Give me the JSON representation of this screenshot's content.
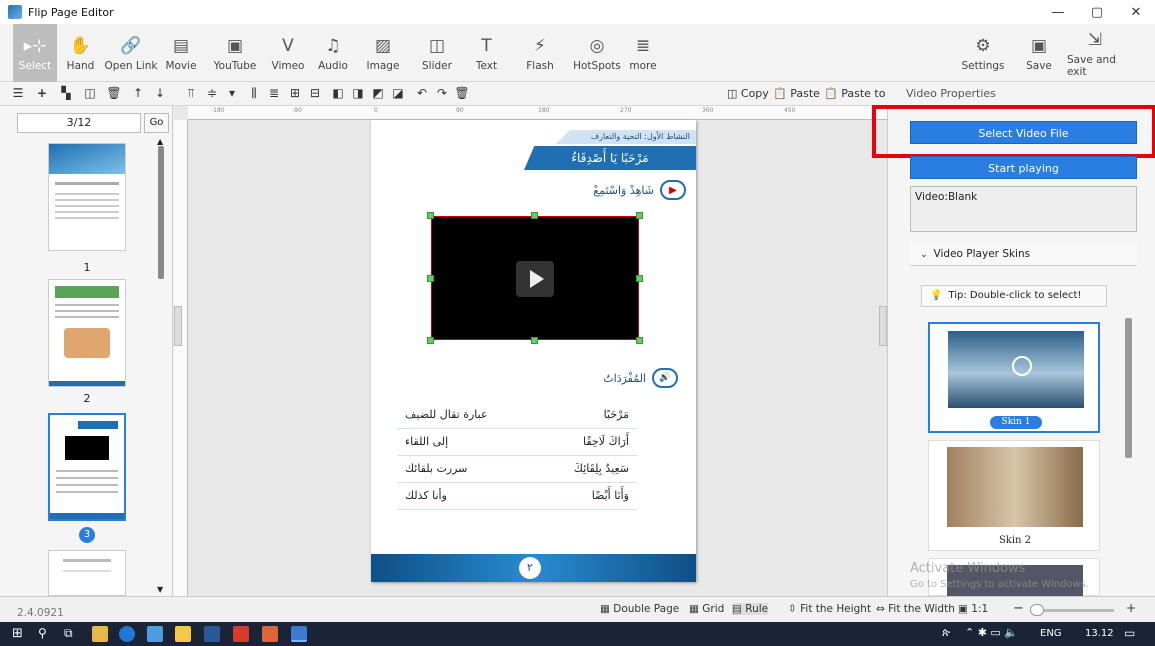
{
  "window": {
    "title": "Flip Page Editor",
    "min": "—",
    "max": "▢",
    "close": "✕"
  },
  "toolbar": [
    {
      "label": "Select",
      "icon": "▸⊹",
      "name": "select"
    },
    {
      "label": "Hand",
      "icon": "✋",
      "name": "hand"
    },
    {
      "label": "Open Link",
      "icon": "🔗",
      "name": "open-link"
    },
    {
      "label": "Movie",
      "icon": "▤",
      "name": "movie"
    },
    {
      "label": "YouTube",
      "icon": "▣",
      "name": "youtube"
    },
    {
      "label": "Vimeo",
      "icon": "V",
      "name": "vimeo"
    },
    {
      "label": "Audio",
      "icon": "♫",
      "name": "audio"
    },
    {
      "label": "Image",
      "icon": "▨",
      "name": "image"
    },
    {
      "label": "Slider",
      "icon": "◫",
      "name": "slider"
    },
    {
      "label": "Text",
      "icon": "T",
      "name": "text"
    },
    {
      "label": "Flash",
      "icon": "⚡",
      "name": "flash"
    },
    {
      "label": "HotSpots",
      "icon": "◎",
      "name": "hotspots"
    },
    {
      "label": "more",
      "icon": "≣",
      "name": "more"
    }
  ],
  "toolbar_right": [
    {
      "label": "Settings",
      "icon": "⚙",
      "name": "settings"
    },
    {
      "label": "Save",
      "icon": "▣",
      "name": "save"
    },
    {
      "label": "Save and exit",
      "icon": "⇲",
      "name": "save-and-exit"
    }
  ],
  "subtoolbar": {
    "copy": "Copy",
    "paste": "Paste",
    "paste_to": "Paste to",
    "panel_title": "Video Properties"
  },
  "pages": {
    "current": "3/12",
    "go": "Go",
    "thumbs": [
      "1",
      "2",
      "3"
    ]
  },
  "ruler": [
    "-180",
    "-90",
    "0",
    "90",
    "180",
    "270",
    "360",
    "450"
  ],
  "page_content": {
    "header_small": "النشاط الأول: التحية والتعارف",
    "banner": "مَرْحَبًا يَا أَصْدِقَاءُ",
    "listen": "شَاهِدْ وَاسْتَمِعْ",
    "vocab_title": "المُفْرَدَاتُ",
    "vocab": [
      {
        "word": "مَرْحَبًا",
        "meaning": "عبارة تقال للضيف"
      },
      {
        "word": "أَرَاكَ لَاحِقًا",
        "meaning": "إلى اللقاء"
      },
      {
        "word": "سَعِيدٌ بِلِقَائِكَ",
        "meaning": "سررت بلقائك"
      },
      {
        "word": "وَأَنَا أَيْضًا",
        "meaning": "وأنا كذلك"
      }
    ],
    "page_number": "٢"
  },
  "properties": {
    "select_video": "Select Video File",
    "start_playing": "Start playing",
    "video_value": "Video:Blank",
    "skins_title": "Video Player Skins",
    "tip": "Tip: Double-click to select!",
    "skin1": "Skin 1",
    "skin2": "Skin 2",
    "watermark1": "Activate Windows",
    "watermark2": "Go to Settings to activate Windows."
  },
  "statusbar": {
    "version": "2.4.0921",
    "double_page": "Double Page",
    "grid": "Grid",
    "rule": "Rule",
    "fit_height": "Fit the Height",
    "fit_width": "Fit the Width",
    "one_to_one": "1:1",
    "zoom_minus": "−",
    "zoom_plus": "+"
  },
  "taskbar": {
    "lang": "ENG",
    "time": "13.12"
  },
  "colors": {
    "accent": "#2a7de1",
    "highlight": "#e8000d",
    "banner": "#1f6fb2"
  }
}
